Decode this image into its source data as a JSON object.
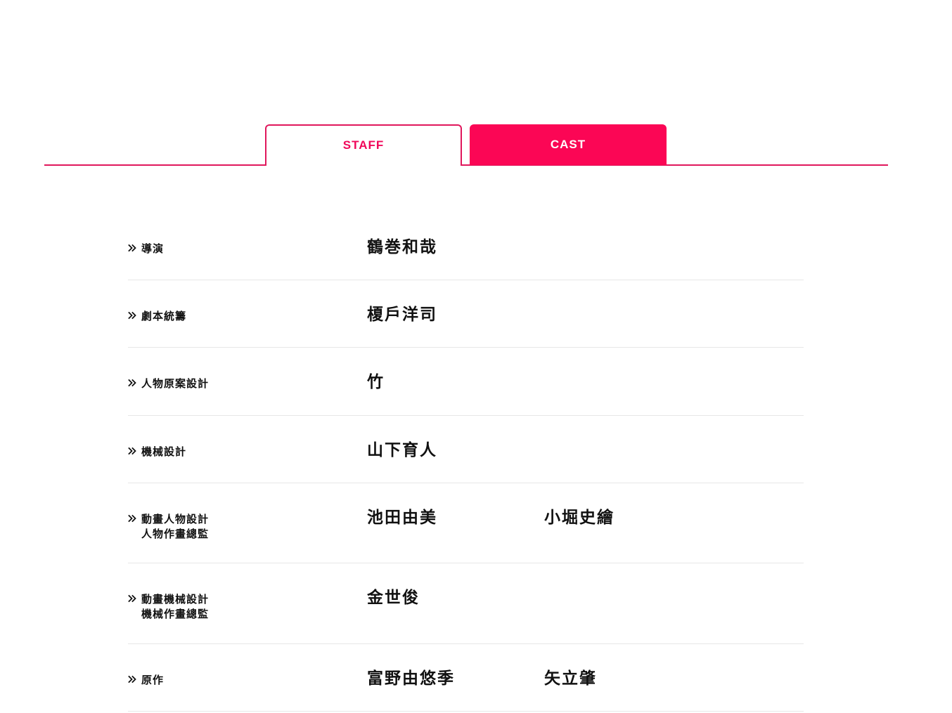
{
  "tabs": {
    "staff_label": "STAFF",
    "cast_label": "CAST",
    "active": "STAFF",
    "accent_color": "#fb0655"
  },
  "staff": [
    {
      "role_lines": [
        "導演"
      ],
      "names": [
        "鶴巻和哉"
      ]
    },
    {
      "role_lines": [
        "劇本統籌"
      ],
      "names": [
        "榎戶洋司"
      ]
    },
    {
      "role_lines": [
        "人物原案設計"
      ],
      "names": [
        "竹"
      ]
    },
    {
      "role_lines": [
        "機械設計"
      ],
      "names": [
        "山下育人"
      ]
    },
    {
      "role_lines": [
        "動畫人物設計",
        "人物作畫總監"
      ],
      "names": [
        "池田由美",
        "小堀史繪"
      ]
    },
    {
      "role_lines": [
        "動畫機械設計",
        "機械作畫總監"
      ],
      "names": [
        "金世俊"
      ]
    },
    {
      "role_lines": [
        "原作"
      ],
      "names": [
        "富野由悠季",
        "矢立肇"
      ]
    }
  ],
  "icons": {
    "row_marker": "double-chevron-right-icon"
  }
}
